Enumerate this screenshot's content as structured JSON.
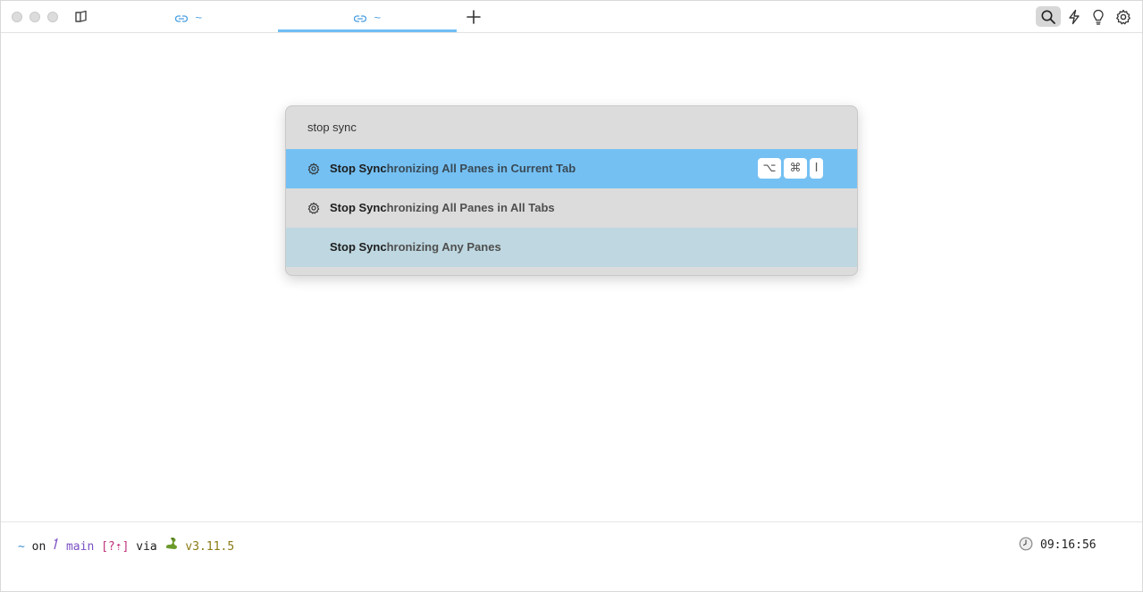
{
  "titlebar": {
    "tabs": [
      {
        "label": "~",
        "active": false
      },
      {
        "label": "~",
        "active": true
      }
    ],
    "new_tab_icon": "plus-icon",
    "toolbar_icons": [
      "search-icon",
      "lightning-bolt-icon",
      "lightbulb-icon",
      "gear-icon"
    ]
  },
  "palette": {
    "query": "stop sync",
    "results": [
      {
        "match": "Stop Sync",
        "rest": "hronizing All Panes in Current Tab",
        "icon": "gear-icon",
        "shortcut": [
          "⌥",
          "⌘",
          "I"
        ],
        "state": "selected"
      },
      {
        "match": "Stop Sync",
        "rest": "hronizing All Panes in All Tabs",
        "icon": "gear-icon",
        "shortcut": [],
        "state": "normal"
      },
      {
        "match": "Stop Sync",
        "rest": "hronizing Any Panes",
        "icon": "",
        "shortcut": [],
        "state": "hover"
      }
    ],
    "colors": {
      "selected": "#74c0f3",
      "hover": "#bed7e0",
      "background": "#dcdcdc"
    }
  },
  "prompt": {
    "dir": "~",
    "on": "on",
    "branch": "main",
    "status": "[?⇡]",
    "via": "via",
    "python_version": "v3.11.5",
    "time": "09:16:56"
  }
}
